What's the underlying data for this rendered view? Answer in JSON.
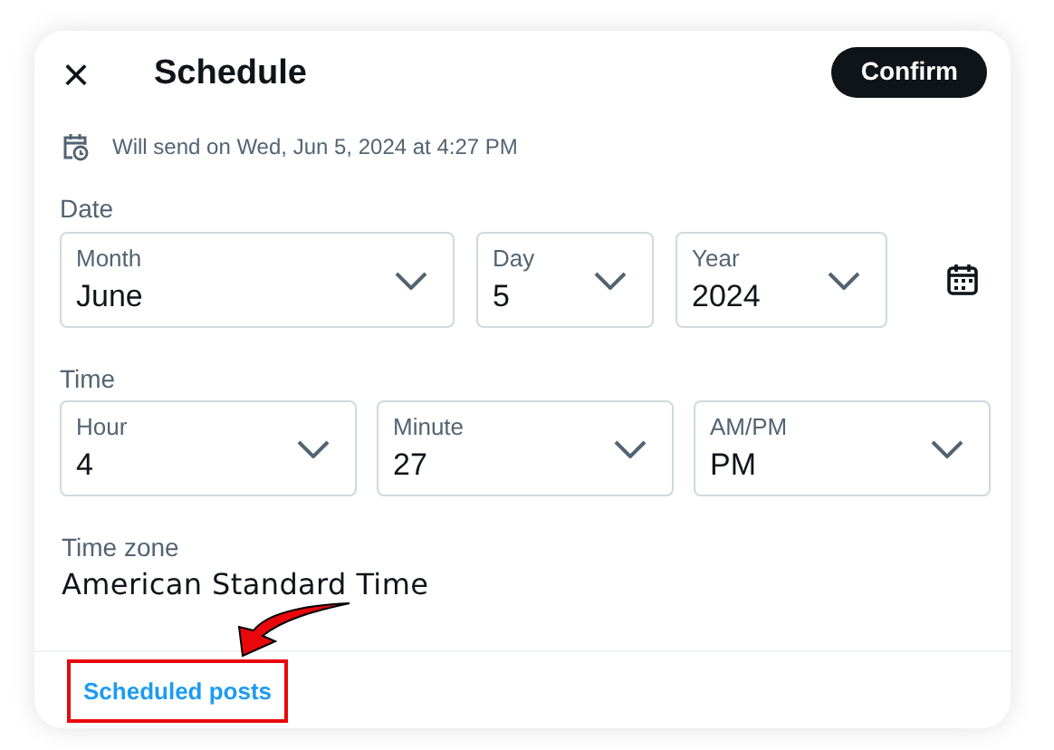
{
  "dialog": {
    "close": "×",
    "title": "Schedule",
    "confirm": "Confirm"
  },
  "send_info": "Will send on Wed, Jun 5, 2024 at 4:27 PM",
  "date": {
    "label": "Date",
    "selects": [
      {
        "label": "Month",
        "value": "June"
      },
      {
        "label": "Day",
        "value": "5"
      },
      {
        "label": "Year",
        "value": "2024"
      }
    ]
  },
  "time": {
    "label": "Time",
    "selects": [
      {
        "label": "Hour",
        "value": "4"
      },
      {
        "label": "Minute",
        "value": "27"
      },
      {
        "label": "AM/PM",
        "value": "PM"
      }
    ]
  },
  "time_zone": {
    "label": "Time zone",
    "value": "American Standard Time"
  },
  "footer": {
    "link": "Scheduled posts",
    "highlighted": true
  }
}
